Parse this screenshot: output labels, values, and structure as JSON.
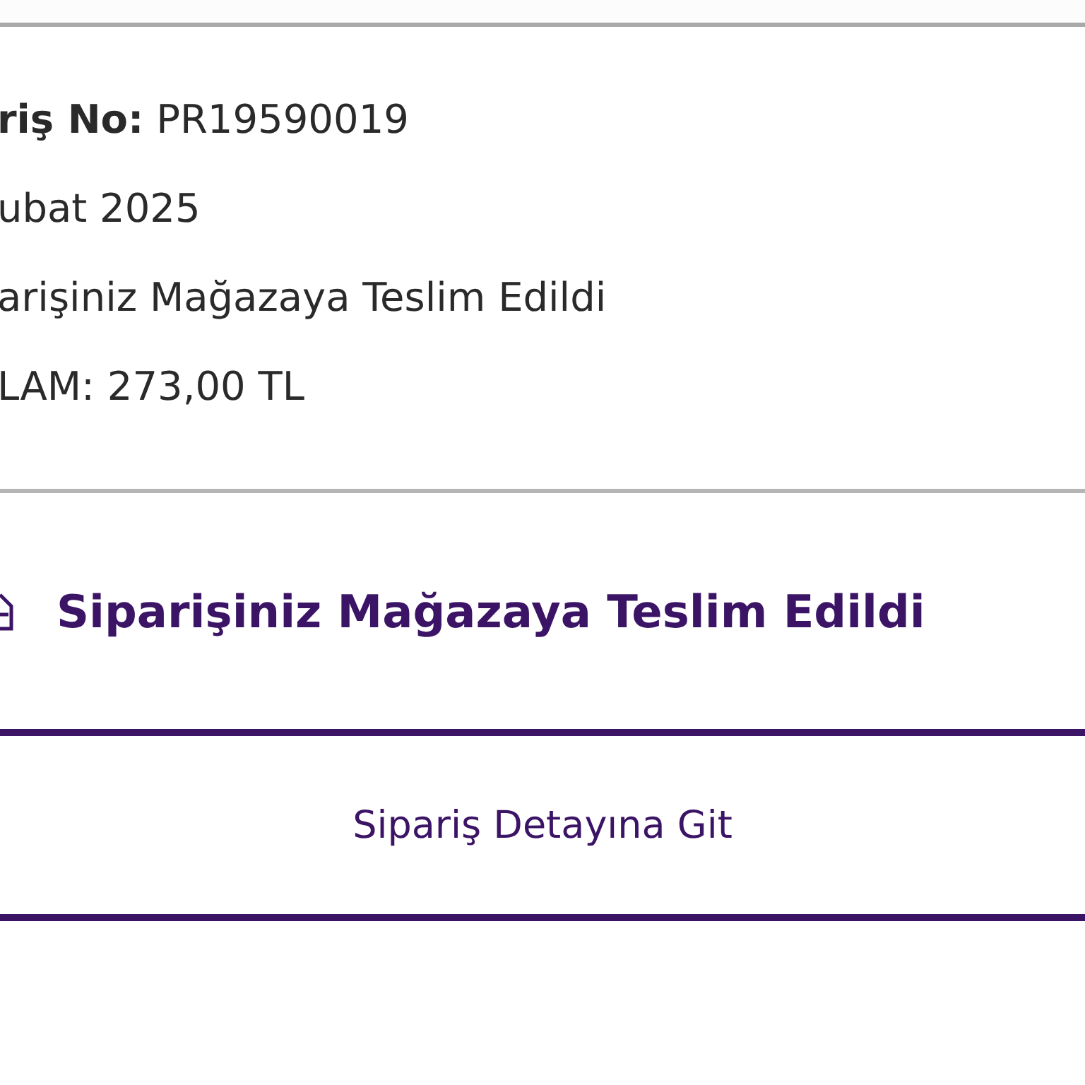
{
  "order_info": {
    "lines": [
      {
        "text": "**riş No:** PR19590019"
      },
      {
        "text": "ubat 2025"
      },
      {
        "text": "arişiniz Mağazaya Teslim Edildi"
      },
      {
        "text": "LAM: 273,00 TL"
      }
    ]
  },
  "status": {
    "title": "Siparişiniz Mağazaya Teslim Edildi"
  },
  "action": {
    "label": "Sipariş Detayına Git"
  }
}
